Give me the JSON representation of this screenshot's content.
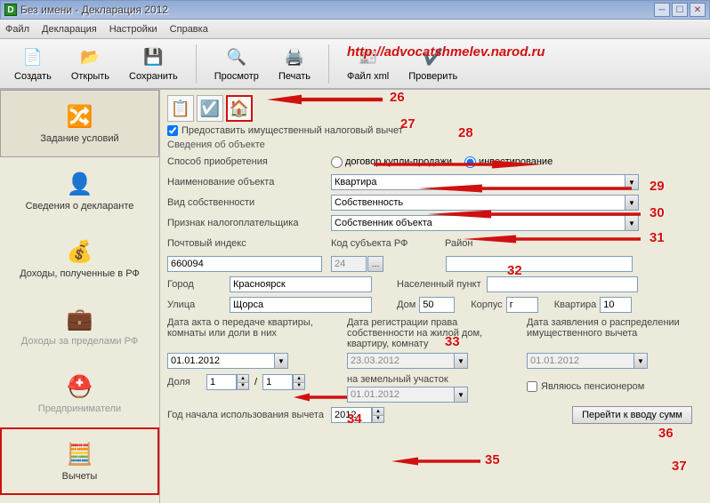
{
  "window": {
    "title": "Без имени - Декларация 2012"
  },
  "menu": {
    "file": "Файл",
    "decl": "Декларация",
    "settings": "Настройки",
    "help": "Справка"
  },
  "toolbar": {
    "create": "Создать",
    "open": "Открыть",
    "save": "Сохранить",
    "preview": "Просмотр",
    "print": "Печать",
    "xml": "Файл xml",
    "check": "Проверить"
  },
  "watermark": "http://advocatshmelev.narod.ru",
  "sidebar": [
    {
      "label": "Задание условий"
    },
    {
      "label": "Сведения о декларанте"
    },
    {
      "label": "Доходы, полученные в РФ"
    },
    {
      "label": "Доходы за пределами РФ"
    },
    {
      "label": "Предприниматели"
    },
    {
      "label": "Вычеты"
    }
  ],
  "form": {
    "provide_vychet": "Предоставить имущественный налоговый вычет",
    "section_obj": "Сведения об объекте",
    "acq_label": "Способ приобретения",
    "acq_radio1": "договор купли-продажи",
    "acq_radio2": "инвестирование",
    "name_label": "Наименование объекта",
    "name_value": "Квартира",
    "own_label": "Вид собственности",
    "own_value": "Собственность",
    "tax_label": "Признак налогоплательщика",
    "tax_value": "Собственник объекта",
    "zip_label": "Почтовый индекс",
    "zip_value": "660094",
    "region_label": "Код субъекта РФ",
    "region_value": "24",
    "raion_label": "Район",
    "city_label": "Город",
    "city_value": "Красноярск",
    "nasp_label": "Населенный пункт",
    "street_label": "Улица",
    "street_value": "Щорса",
    "house_label": "Дом",
    "house_value": "50",
    "korp_label": "Корпус",
    "korp_value": "г",
    "apt_label": "Квартира",
    "apt_value": "10",
    "date1_label": "Дата акта о передаче квартиры, комнаты или доли в них",
    "date1_value": "01.01.2012",
    "date2_label": "Дата регистрации права собственности на жилой дом, квартиру, комнату",
    "date2_value": "23.03.2012",
    "date3_label": "Дата заявления о распределении имущественного вычета",
    "date3_value": "01.01.2012",
    "share_label": "Доля",
    "share_num": "1",
    "share_den": "1",
    "land_label": "на земельный участок",
    "land_value": "01.01.2012",
    "pension_label": "Являюсь пенсионером",
    "yearuse_label": "Год начала использования вычета",
    "yearuse_value": "2012",
    "go_sums": "Перейти к вводу сумм"
  },
  "annotations": {
    "n26": "26",
    "n27": "27",
    "n28": "28",
    "n29": "29",
    "n30": "30",
    "n31": "31",
    "n32": "32",
    "n33": "33",
    "n34": "34",
    "n35": "35",
    "n36": "36",
    "n37": "37"
  }
}
